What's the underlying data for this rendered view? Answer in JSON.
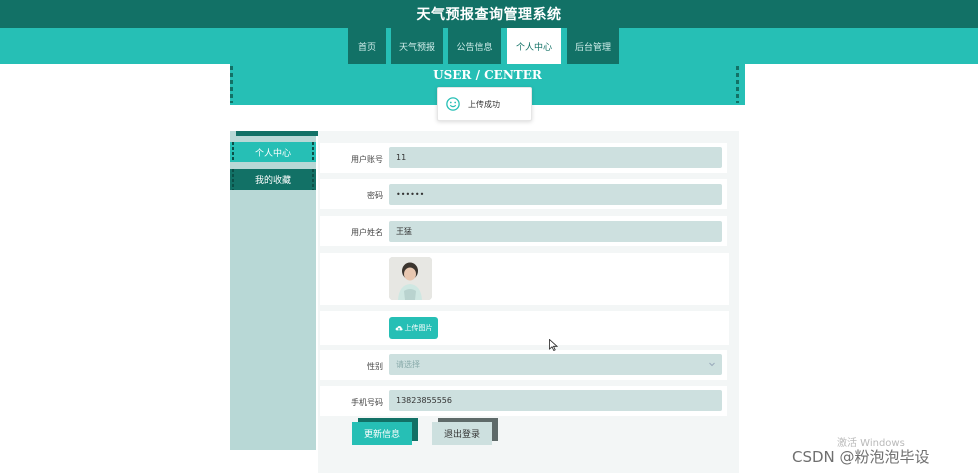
{
  "app": {
    "title": "天气预报查询管理系统"
  },
  "nav": {
    "items": [
      {
        "label": "首页"
      },
      {
        "label": "天气预报"
      },
      {
        "label": "公告信息"
      },
      {
        "label": "个人中心"
      },
      {
        "label": "后台管理"
      }
    ],
    "active": "个人中心"
  },
  "banner": {
    "title": "USER / CENTER"
  },
  "toast": {
    "message": "上传成功",
    "icon": "smile-icon"
  },
  "sidebar": {
    "items": [
      {
        "label": "个人中心"
      },
      {
        "label": "我的收藏"
      }
    ]
  },
  "form": {
    "username": {
      "label": "用户账号",
      "value": "11"
    },
    "password": {
      "label": "密码",
      "value": "••••••"
    },
    "name": {
      "label": "用户姓名",
      "value": "王猛"
    },
    "avatar": {
      "icon": "avatar-photo"
    },
    "upload": {
      "label": "上传图片",
      "icon": "cloud-upload-icon"
    },
    "gender": {
      "label": "性别",
      "placeholder": "请选择"
    },
    "phone": {
      "label": "手机号码",
      "value": "13823855556"
    }
  },
  "actions": {
    "update": "更新信息",
    "logout": "退出登录"
  },
  "watermark": {
    "activate": "激活 Windows",
    "source": "CSDN @粉泡泡毕设"
  },
  "colors": {
    "dark_teal": "#127166",
    "teal": "#26bfb5",
    "field_bg": "#cde0df",
    "sidebar_bg": "#b8d8d6"
  }
}
